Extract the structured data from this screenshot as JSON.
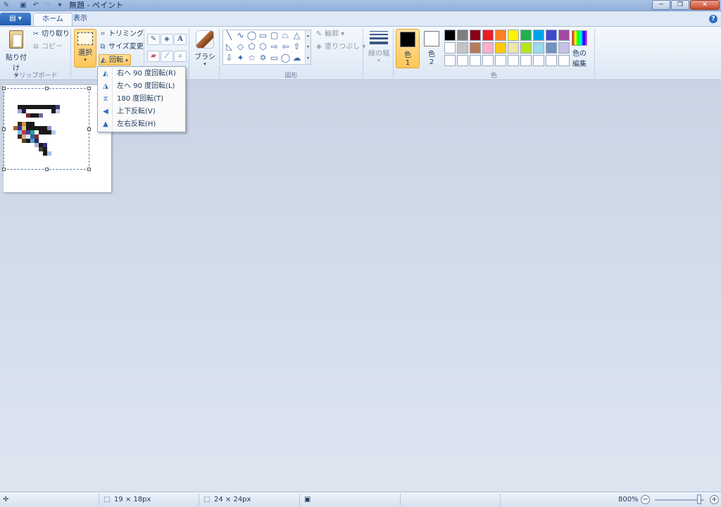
{
  "window": {
    "title": "無題 - ペイント",
    "minimize": "─",
    "maximize": "❐",
    "close": "✕"
  },
  "quick_access": {
    "save_icon": "save-icon",
    "undo_icon": "undo-icon",
    "redo_icon": "redo-icon"
  },
  "tabs": {
    "app_menu": "▤ ▾",
    "home": "ホーム",
    "view": "表示"
  },
  "clipboard": {
    "paste": "貼り付け",
    "cut": "切り取り",
    "copy": "コピー",
    "group_label": "クリップボード"
  },
  "image": {
    "select": "選択",
    "crop": "トリミング",
    "resize": "サイズ変更",
    "rotate": "回転"
  },
  "brushes": {
    "label": "ブラシ"
  },
  "shapes": {
    "outline": "輪郭",
    "fill": "塗りつぶし",
    "group_label": "図形"
  },
  "size": {
    "label": "線の幅"
  },
  "colors": {
    "color1_label": "色\n1",
    "color1_char": "色",
    "color1_num": "1",
    "color2_char": "色",
    "color2_num": "2",
    "color1_value": "#000000",
    "color2_value": "#ffffff",
    "edit_colors_line1": "色の",
    "edit_colors_line2": "編集",
    "group_label": "色",
    "palette_row1": [
      "#000000",
      "#7f7f7f",
      "#880015",
      "#ed1c24",
      "#ff7f27",
      "#fff200",
      "#22b14c",
      "#00a2e8",
      "#3f48cc",
      "#a349a4"
    ],
    "palette_row2": [
      "#ffffff",
      "#c3c3c3",
      "#b97a57",
      "#ffaec9",
      "#ffc90e",
      "#efe4b0",
      "#b5e61d",
      "#99d9ea",
      "#7092be",
      "#c8bfe7"
    ],
    "palette_row3": [
      "#ffffff",
      "#ffffff",
      "#ffffff",
      "#ffffff",
      "#ffffff",
      "#ffffff",
      "#ffffff",
      "#ffffff",
      "#ffffff",
      "#ffffff"
    ]
  },
  "rotate_menu": {
    "items": [
      {
        "label": "右へ 90 度回転(R)",
        "icon": "rotate-right-icon"
      },
      {
        "label": "左へ 90 度回転(L)",
        "icon": "rotate-left-icon"
      },
      {
        "label": "180 度回転(T)",
        "icon": "rotate-180-icon"
      },
      {
        "label": "上下反転(V)",
        "icon": "flip-vertical-icon"
      },
      {
        "label": "左右反転(H)",
        "icon": "flip-horizontal-icon"
      }
    ]
  },
  "status": {
    "selection_size": "19 × 18px",
    "image_size": "24 × 24px",
    "zoom": "800%",
    "zoom_level_fraction": 0.9
  }
}
